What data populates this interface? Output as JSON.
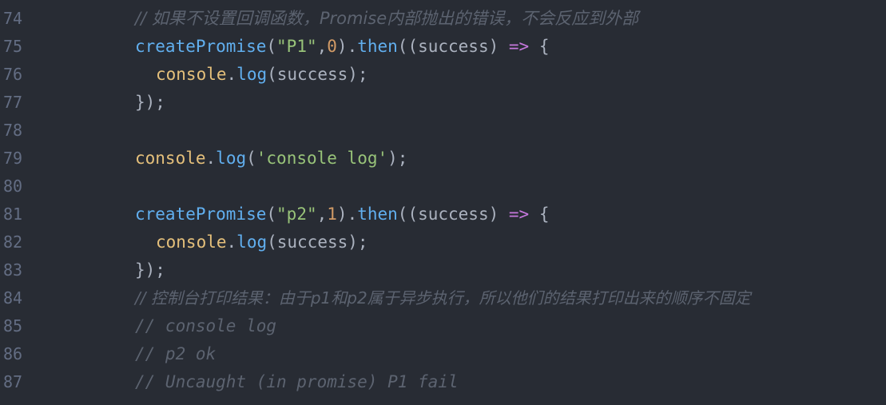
{
  "editor": {
    "lines": [
      {
        "num": "74",
        "comment": "// 如果不设置回调函数，Promise内部抛出的错误，不会反应到外部"
      },
      {
        "num": "75",
        "fn": "createPromise",
        "open": "(",
        "str": "\"P1\"",
        "comma": ",",
        "numArg": "0",
        "close1": ").",
        "then": "then",
        "open2": "((",
        "param": "success",
        "close2": ") ",
        "arrow": "=>",
        "brace": " {"
      },
      {
        "num": "76",
        "obj": "console",
        "dot": ".",
        "method": "log",
        "rest": "(success);"
      },
      {
        "num": "77",
        "text": "});"
      },
      {
        "num": "78"
      },
      {
        "num": "79",
        "obj": "console",
        "dot": ".",
        "method": "log",
        "open": "(",
        "str": "'console log'",
        "rest": ");"
      },
      {
        "num": "80"
      },
      {
        "num": "81",
        "fn": "createPromise",
        "open": "(",
        "str": "\"p2\"",
        "comma": ",",
        "numArg": "1",
        "close1": ").",
        "then": "then",
        "open2": "((",
        "param": "success",
        "close2": ") ",
        "arrow": "=>",
        "brace": " {"
      },
      {
        "num": "82",
        "obj": "console",
        "dot": ".",
        "method": "log",
        "rest": "(success);"
      },
      {
        "num": "83",
        "text": "});"
      },
      {
        "num": "84",
        "comment": "// 控制台打印结果：由于p1和p2属于异步执行，所以他们的结果打印出来的顺序不固定"
      },
      {
        "num": "85",
        "comment": "// console log"
      },
      {
        "num": "86",
        "comment": "// p2 ok"
      },
      {
        "num": "87",
        "comment": "// Uncaught (in promise) P1 fail"
      }
    ]
  }
}
